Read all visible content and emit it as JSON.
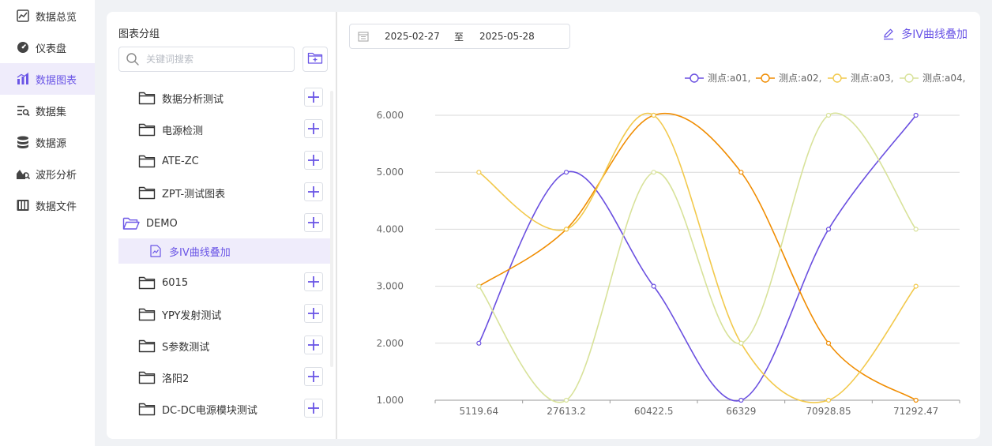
{
  "nav": {
    "items": [
      {
        "label": "数据总览",
        "icon": "dashboard-overview-icon"
      },
      {
        "label": "仪表盘",
        "icon": "gauge-icon"
      },
      {
        "label": "数据图表",
        "icon": "bar-chart-icon",
        "active": true
      },
      {
        "label": "数据集",
        "icon": "dataset-icon"
      },
      {
        "label": "数据源",
        "icon": "database-icon"
      },
      {
        "label": "波形分析",
        "icon": "waveform-analysis-icon"
      },
      {
        "label": "数据文件",
        "icon": "data-file-icon"
      }
    ]
  },
  "tree": {
    "title": "图表分组",
    "search_placeholder": "关键词搜索",
    "groups": [
      {
        "label": "数据分析测试"
      },
      {
        "label": "电源检测"
      },
      {
        "label": "ATE-ZC"
      },
      {
        "label": "ZPT-测试图表"
      },
      {
        "label": "DEMO",
        "expanded": true
      },
      {
        "label": "6015"
      },
      {
        "label": "YPY发射测试"
      },
      {
        "label": "S参数测试"
      },
      {
        "label": "洛阳2"
      },
      {
        "label": "DC-DC电源模块测试"
      }
    ],
    "demo_child": "多IV曲线叠加"
  },
  "toolbar": {
    "date_start": "2025-02-27",
    "date_sep": "至",
    "date_end": "2025-05-28",
    "chart_title": "多IV曲线叠加"
  },
  "colors": {
    "accent": "#6a55e6",
    "series": [
      "#6a4fe0",
      "#f08c00",
      "#f2c94c",
      "#d8e29a"
    ]
  },
  "chart_data": {
    "type": "line",
    "smooth": true,
    "categories": [
      "5119.64",
      "27613.2",
      "60422.5",
      "66329",
      "70928.85",
      "71292.47"
    ],
    "ylim": [
      1,
      6
    ],
    "yticks": [
      "6.000",
      "5.000",
      "4.000",
      "3.000",
      "2.000",
      "1.000"
    ],
    "ytick_values": [
      6,
      5,
      4,
      3,
      2,
      1
    ],
    "legend_position": "top-right",
    "grid": true,
    "series": [
      {
        "name": "测点:a01,",
        "values": [
          2,
          5,
          3,
          1,
          4,
          6
        ]
      },
      {
        "name": "测点:a02,",
        "values": [
          3,
          4,
          6,
          5,
          2,
          1
        ]
      },
      {
        "name": "测点:a03,",
        "values": [
          5,
          4,
          6,
          2,
          1,
          3
        ]
      },
      {
        "name": "测点:a04,",
        "values": [
          3,
          1,
          5,
          2,
          6,
          4
        ]
      }
    ]
  }
}
